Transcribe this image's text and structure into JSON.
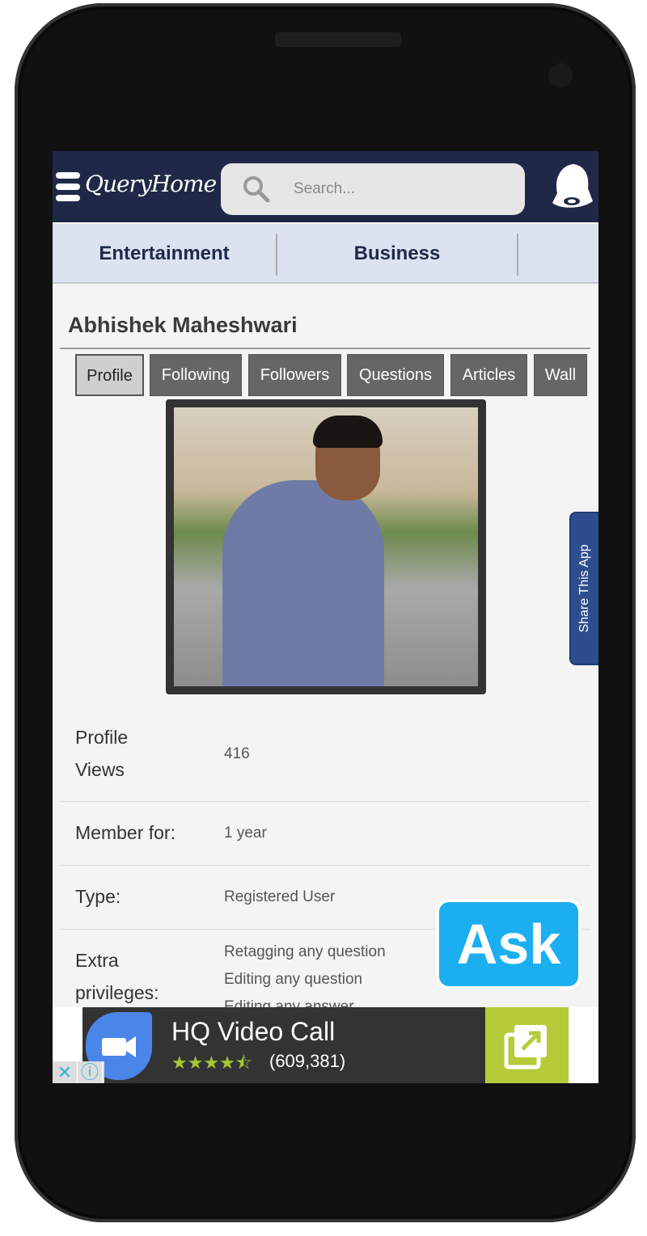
{
  "header": {
    "logo": "QueryHome",
    "search_placeholder": "Search...",
    "icons": [
      "hamburger-menu-icon",
      "search-icon",
      "bell-icon"
    ]
  },
  "categories": [
    "Entertainment",
    "Business"
  ],
  "profile": {
    "name": "Abhishek Maheshwari",
    "tabs": [
      {
        "label": "Profile",
        "active": true
      },
      {
        "label": "Following"
      },
      {
        "label": "Followers"
      },
      {
        "label": "Questions"
      },
      {
        "label": "Articles"
      },
      {
        "label": "Wall"
      }
    ],
    "fields": [
      {
        "label": "Profile Views",
        "value": "416"
      },
      {
        "label": "Member for:",
        "value": "1 year"
      },
      {
        "label": "Type:",
        "value": "Registered User"
      },
      {
        "label": "Extra privileges:",
        "values": [
          "Retagging any question",
          "Editing any question",
          "Editing any answer"
        ]
      }
    ]
  },
  "share_label": "Share This App",
  "ask_label": "Ask",
  "ad": {
    "title": "HQ Video Call",
    "rating": 4.5,
    "stars": "★★★★⯪",
    "count": "(609,381)",
    "close": "✕",
    "info": "ⓘ"
  },
  "colors": {
    "header": "#1f2947",
    "category_bar": "#dce2ef",
    "ask": "#1baff0",
    "ad_button": "#b5cb3a",
    "share": "#2d4d8f"
  }
}
